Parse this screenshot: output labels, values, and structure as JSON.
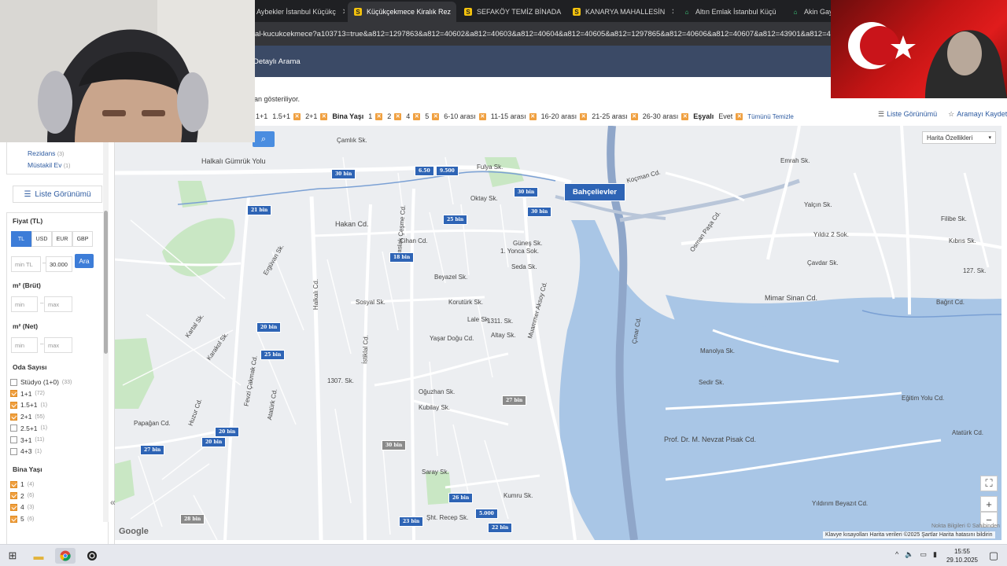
{
  "browser": {
    "tabs": [
      {
        "title": "Aybekler İstanbul Küçükç",
        "fav": "",
        "active": false
      },
      {
        "title": "Küçükçekmece Kiralık Rez",
        "fav": "S",
        "active": true
      },
      {
        "title": "SEFAKÖY TEMİZ BİNADA",
        "fav": "S",
        "active": false
      },
      {
        "title": "KANARYA MAHALLESİN",
        "fav": "S",
        "active": false
      },
      {
        "title": "Altın Emlak İstanbul Küçü",
        "fav": "⌂",
        "active": false
      },
      {
        "title": "Akin Gayri",
        "fav": "⌂",
        "active": false
      }
    ],
    "url": "al-kucukcekmece?a103713=true&a812=1297863&a812=40602&a812=40603&a812=40604&a812=40605&a812=1297865&a812=40606&a812=40607&a812=43901&a812=4390"
  },
  "header": {
    "detailed_search": "Detaylı Arama"
  },
  "notice": "dan gösteriliyor.",
  "chips": {
    "items": [
      {
        "label": "1+1",
        "x": false
      },
      {
        "label": "1.5+1",
        "x": true
      },
      {
        "label": "2+1",
        "x": true
      },
      {
        "label": "Bina Yaşı",
        "strong": true
      },
      {
        "label": "1",
        "x": true
      },
      {
        "label": "2",
        "x": true
      },
      {
        "label": "4",
        "x": true
      },
      {
        "label": "5",
        "x": true
      },
      {
        "label": "6-10 arası",
        "x": true
      },
      {
        "label": "11-15 arası",
        "x": true
      },
      {
        "label": "16-20 arası",
        "x": true
      },
      {
        "label": "21-25 arası",
        "x": true
      },
      {
        "label": "26-30 arası",
        "x": true
      },
      {
        "label": "Eşyalı",
        "strong": true
      },
      {
        "label": "Evet",
        "x": true
      }
    ],
    "clear_all": "Tümünü Temizle",
    "list_view": "Liste Görünümü",
    "save_search": "Aramayı Kaydet"
  },
  "sidebar": {
    "types": [
      {
        "label": "Rezidans",
        "count": "(3)"
      },
      {
        "label": "Müstakil Ev",
        "count": "(1)"
      }
    ],
    "list_view": "Liste Görünümü",
    "price_label": "Fiyat (TL)",
    "currencies": [
      "TL",
      "USD",
      "EUR",
      "GBP"
    ],
    "price_min_placeholder": "min TL",
    "price_max": "30.000",
    "search_btn": "Ara",
    "m2_brut": "m² (Brüt)",
    "m2_net": "m² (Net)",
    "min": "min",
    "max": "max",
    "room_label": "Oda Sayısı",
    "rooms": [
      {
        "label": "Stüdyo (1+0)",
        "count": "(33)",
        "checked": false
      },
      {
        "label": "1+1",
        "count": "(72)",
        "checked": true
      },
      {
        "label": "1.5+1",
        "count": "(1)",
        "checked": true
      },
      {
        "label": "2+1",
        "count": "(55)",
        "checked": true
      },
      {
        "label": "2.5+1",
        "count": "(1)",
        "checked": false
      },
      {
        "label": "3+1",
        "count": "(11)",
        "checked": false
      },
      {
        "label": "4+3",
        "count": "(1)",
        "checked": false
      }
    ],
    "age_label": "Bina Yaşı",
    "ages": [
      {
        "label": "1",
        "count": "(4)",
        "checked": true
      },
      {
        "label": "2",
        "count": "(6)",
        "checked": true
      },
      {
        "label": "4",
        "count": "(3)",
        "checked": true
      },
      {
        "label": "5",
        "count": "(6)",
        "checked": true
      }
    ]
  },
  "map": {
    "features_btn": "Harita Özellikleri",
    "popup": "Bahçelievler",
    "pins": [
      "30 bin",
      "6.50",
      "9.500",
      "30 bin",
      "21 bin",
      "30 bin",
      "25 bin",
      "18 bin",
      "20 bin",
      "25 bin",
      "27 bin",
      "20 bin",
      "20 bin",
      "27 bin",
      "30 bin",
      "26 bin",
      "5.000",
      "23 bin",
      "22 bin",
      "28 bin"
    ],
    "streets": [
      "Çamlık Sk.",
      "Halkalı Gümrük Yolu",
      "Hakan Cd.",
      "Oktay Sk.",
      "Fulya Sk.",
      "Cihan Cd.",
      "Güneş Sk.",
      "1. Yonca Sok.",
      "Seda Sk.",
      "Beyazel Sk.",
      "Sosyal Sk.",
      "Korutürk Sk.",
      "Lale Sk.",
      "1311. Sk.",
      "Altay Sk.",
      "Yaşar Doğu Cd.",
      "Oğuzhan Sk.",
      "Kubilay Sk.",
      "Saray Sk.",
      "Şht. Recep Sk.",
      "1307. Sk.",
      "Halkalı Cd.",
      "İstiklal Cd.",
      "Maslak Çeşme Cd.",
      "Muammer Aksoy Cd.",
      "Koçman Cd.",
      "Osman Paşa Cd.",
      "Emrah Sk.",
      "Yalçın Sk.",
      "Yıldız 2 Sok.",
      "Çavdar Sk.",
      "Mimar Sinan Cd.",
      "Bağrıt Cd.",
      "Manolya Sk.",
      "Sedir Sk.",
      "Prof. Dr. M. Nevzat Pisak Cd.",
      "Atatürk Cd.",
      "Yıldırım Beyazıt Cd.",
      "Eğitim Yolu Cd.",
      "Filibe Sk.",
      "Kıbrıs Sk.",
      "127. Sk.",
      "Papağan Cd.",
      "Atatürk Cd.",
      "Fevzi Çakmak Cd.",
      "Huzur Cd.",
      "Kartal Sk.",
      "Karakol Sk.",
      "Ergüvan Sk.",
      "Çınar Cd.",
      "Kumru Sk."
    ],
    "footer": "Klavye kısayolları   Harita verileri ©2025   Şartlar   Harita hatasını bildirin",
    "nokta": "Nokta Bilgileri © Sahibinden",
    "google": "Google"
  },
  "taskbar": {
    "time": "15:55",
    "date": "29.10.2025"
  }
}
